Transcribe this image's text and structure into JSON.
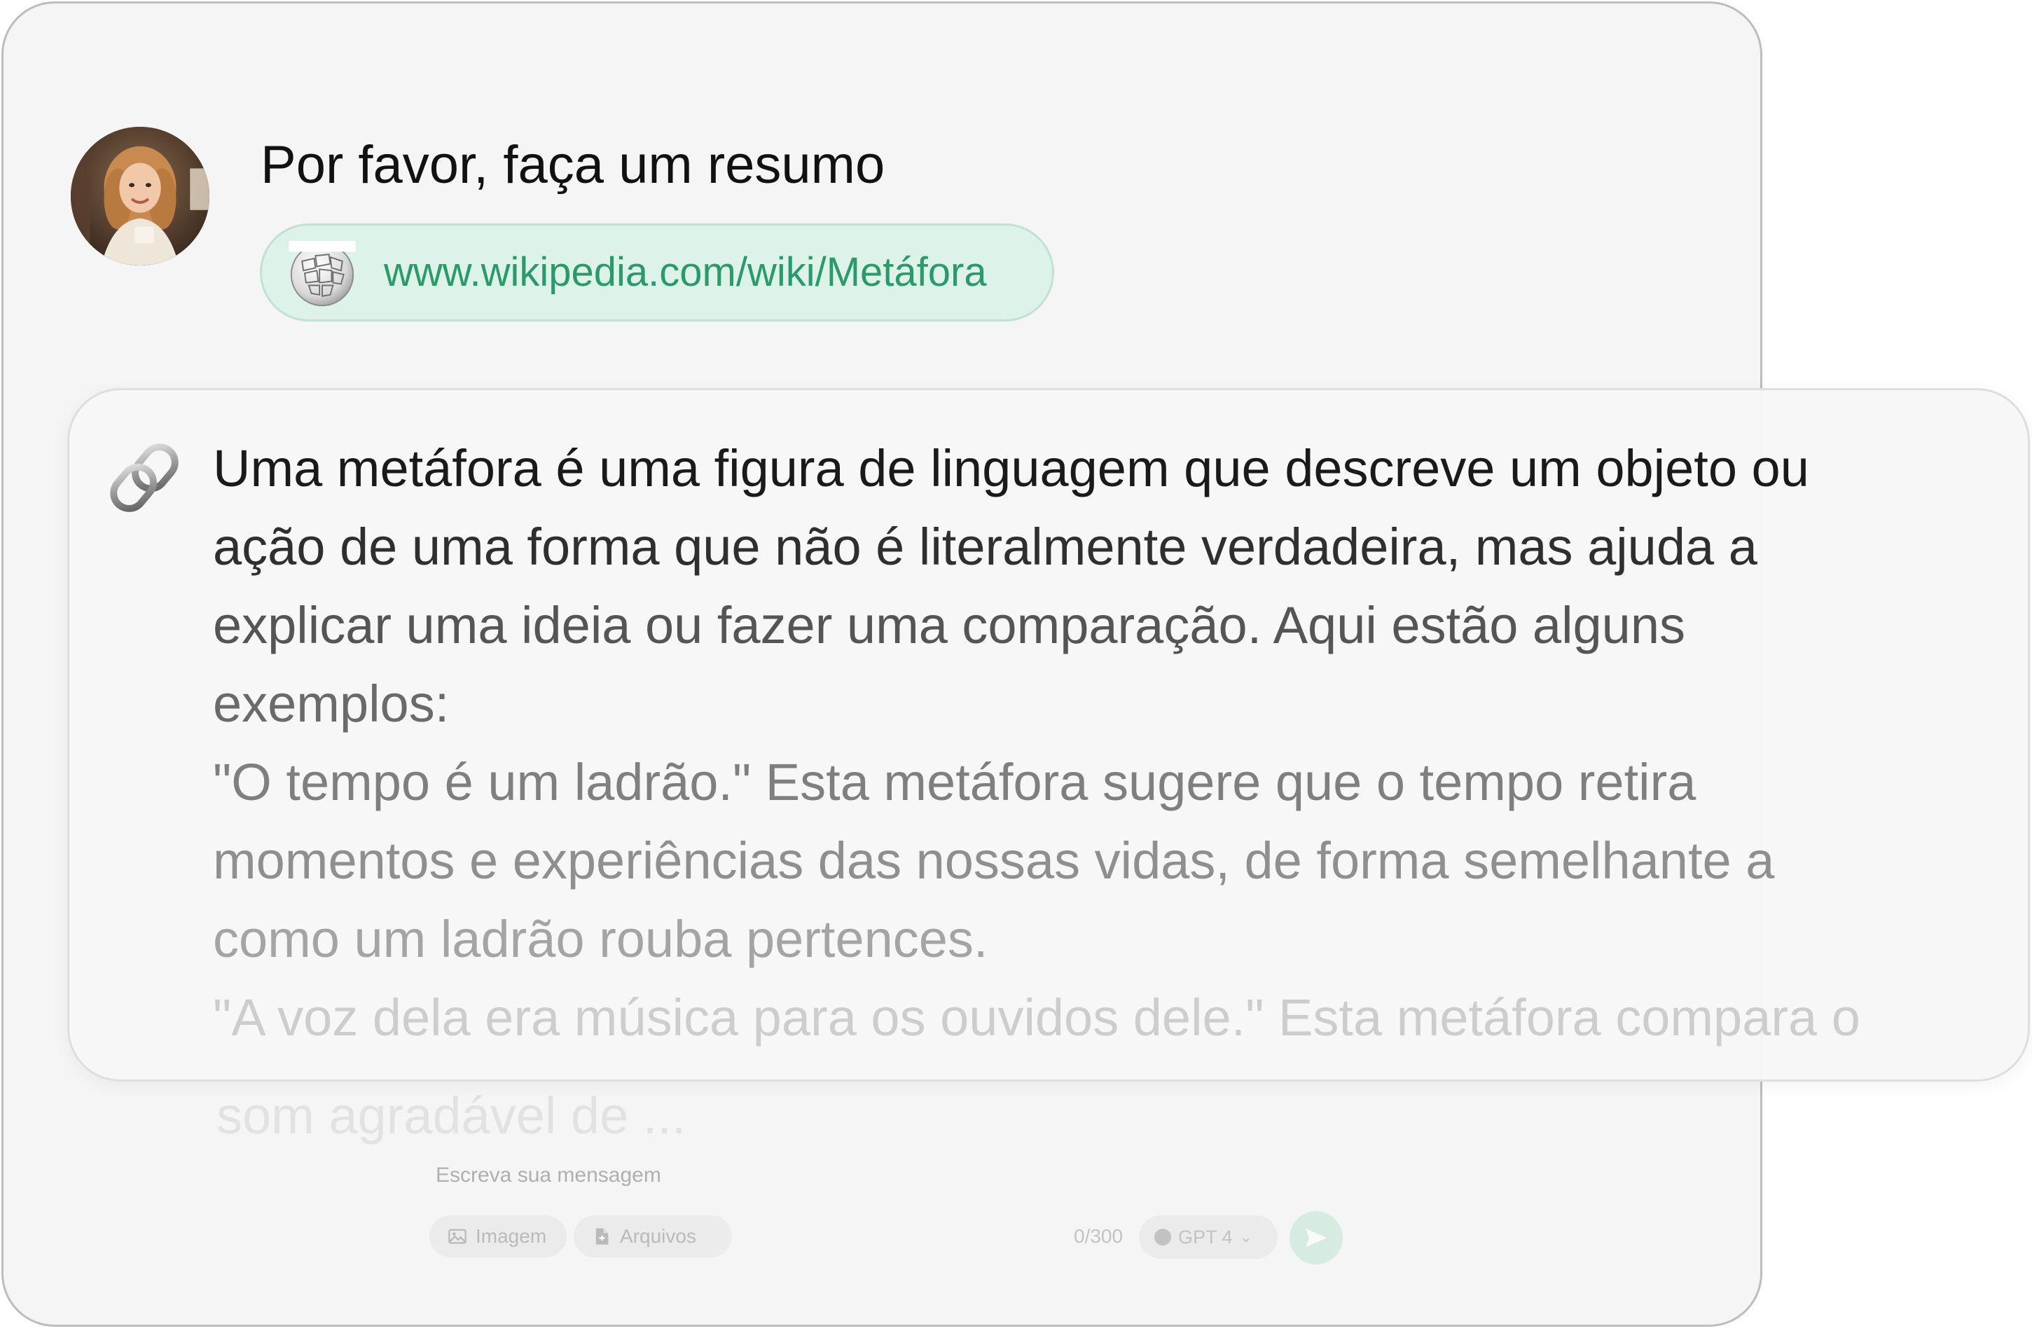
{
  "user": {
    "avatar_icon": "user-avatar-photo",
    "message": "Por favor, faça um resumo"
  },
  "link": {
    "icon": "wikipedia-globe-icon",
    "url": "www.wikipedia.com/wiki/Metáfora"
  },
  "answer": {
    "icon": "link-icon",
    "lines": [
      "Uma metáfora é uma figura de linguagem que descreve um objeto ou",
      "ação de uma forma que não é literalmente verdadeira, mas ajuda a",
      "explicar uma ideia ou fazer uma comparação. Aqui estão alguns",
      "exemplos:",
      "\"O tempo é um ladrão.\" Esta metáfora sugere que o tempo retira",
      "momentos e experiências das nossas vidas, de forma semelhante a",
      "como um ladrão rouba pertences.",
      "\"A voz dela era música para os ouvidos dele.\" Esta metáfora compara o",
      "som agradável de ..."
    ]
  },
  "composer": {
    "placeholder": "Escreva sua mensagem",
    "image_label": "Imagem",
    "files_label": "Arquivos",
    "char_count": "0/300",
    "model": "GPT 4",
    "send_icon": "send-icon"
  },
  "colors": {
    "window_bg": "#f5f5f5",
    "link_chip_bg": "#ddf2e9",
    "link_text": "#2a9a6a",
    "send_button": "#bfe6d2"
  }
}
